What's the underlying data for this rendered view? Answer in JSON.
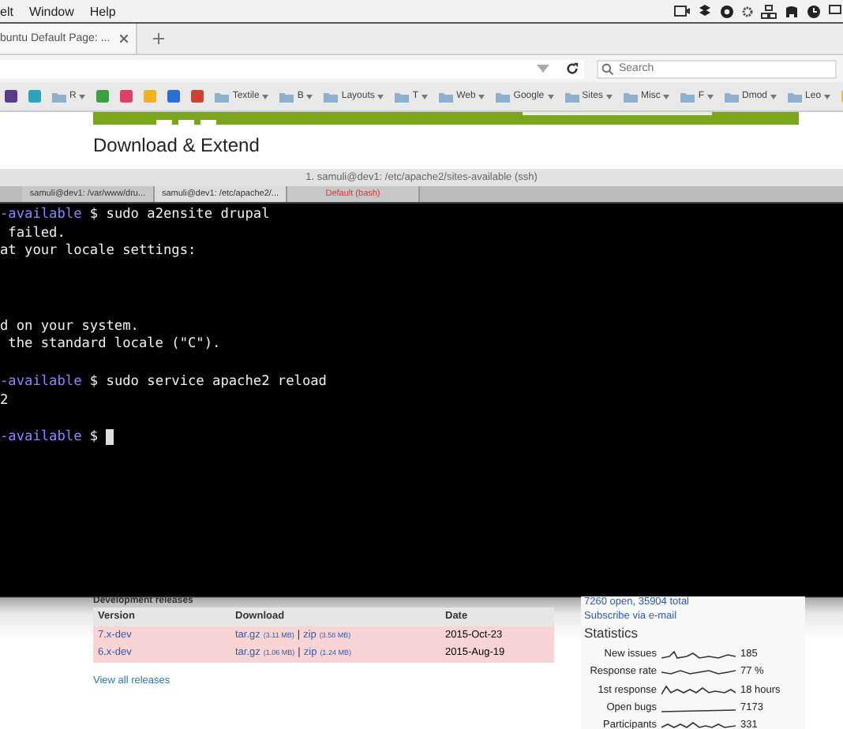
{
  "menu_bar": {
    "items": [
      "elt",
      "Window",
      "Help"
    ]
  },
  "browser": {
    "tabs": [
      {
        "label": "buntu Default Page: ...",
        "selected": true
      }
    ],
    "search": {
      "placeholder": "Search"
    },
    "bookmarks": [
      {
        "kind": "site",
        "color": "#5a3a8c"
      },
      {
        "kind": "site",
        "color": "#2aa4b8"
      },
      {
        "kind": "folder",
        "label": "R"
      },
      {
        "kind": "site",
        "color": "#3aa040"
      },
      {
        "kind": "site",
        "color": "#e0406a"
      },
      {
        "kind": "site",
        "color": "#f0b020"
      },
      {
        "kind": "site",
        "color": "#2a6fd8"
      },
      {
        "kind": "site",
        "color": "#d04030"
      },
      {
        "kind": "folder",
        "label": "Textile"
      },
      {
        "kind": "folder",
        "label": "B"
      },
      {
        "kind": "folder",
        "label": "Layouts"
      },
      {
        "kind": "folder",
        "label": "T"
      },
      {
        "kind": "folder",
        "label": "Web"
      },
      {
        "kind": "folder",
        "label": "Google"
      },
      {
        "kind": "folder",
        "label": "Sites"
      },
      {
        "kind": "folder",
        "label": "Misc"
      },
      {
        "kind": "folder",
        "label": "F"
      },
      {
        "kind": "folder",
        "label": "Dmod"
      },
      {
        "kind": "folder",
        "label": "Leo"
      },
      {
        "kind": "site",
        "color": "#e8c040"
      }
    ]
  },
  "page_heading": "Download & Extend",
  "terminal": {
    "title": "1. samuli@dev1: /etc/apache2/sites-available (ssh)",
    "tabs": [
      {
        "label": "samuli@dev1: /var/www/dru...",
        "selected": false,
        "alert": false
      },
      {
        "label": "samuli@dev1: /etc/apache2/...",
        "selected": true,
        "alert": false
      },
      {
        "label": "Default (bash)",
        "selected": false,
        "alert": true
      }
    ],
    "lines": [
      {
        "kind": "prompt",
        "prompt": "-available",
        "text": " $ sudo a2ensite drupal"
      },
      {
        "kind": "output",
        "text": " failed."
      },
      {
        "kind": "output",
        "text": "at your locale settings:"
      },
      {
        "kind": "blank"
      },
      {
        "kind": "blank"
      },
      {
        "kind": "blank"
      },
      {
        "kind": "output",
        "text": "d on your system."
      },
      {
        "kind": "output",
        "text": " the standard locale (\"C\")."
      },
      {
        "kind": "blank"
      },
      {
        "kind": "prompt",
        "prompt": "-available",
        "text": " $ sudo service apache2 reload"
      },
      {
        "kind": "output",
        "text": "2"
      },
      {
        "kind": "blank"
      },
      {
        "kind": "prompt",
        "prompt": "-available",
        "text": " $ ",
        "cursor": true
      }
    ]
  },
  "releases": {
    "heading": "Development releases",
    "columns": [
      "Version",
      "Download",
      "Date"
    ],
    "rows": [
      {
        "version": "7.x-dev",
        "tar": "tar.gz",
        "tar_size": "(3.11 MB)",
        "separator": "|",
        "zip": "zip",
        "zip_size": "(3.58 MB)",
        "date": "2015-Oct-23"
      },
      {
        "version": "6.x-dev",
        "tar": "tar.gz",
        "tar_size": "(1.06 MB)",
        "separator": "|",
        "zip": "zip",
        "zip_size": "(1.24 MB)",
        "date": "2015-Aug-19"
      }
    ],
    "link": "View all releases"
  },
  "sidebar": {
    "issues": "7260 open, 35904 total",
    "subscribe": "Subscribe via e-mail",
    "heading": "Statistics",
    "stats": [
      {
        "label": "New issues",
        "value": "185"
      },
      {
        "label": "Response rate",
        "value": "77 %"
      },
      {
        "label": "1st response",
        "value": "18 hours"
      },
      {
        "label": "Open bugs",
        "value": "7173"
      },
      {
        "label": "Participants",
        "value": "331"
      }
    ]
  }
}
